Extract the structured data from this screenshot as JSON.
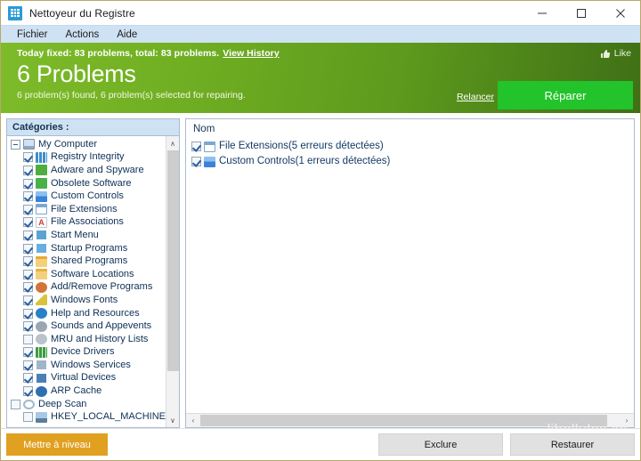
{
  "window": {
    "title": "Nettoyeur du Registre",
    "icon": "registry-app-icon",
    "minimize": "─",
    "maximize": "□",
    "close": "✕"
  },
  "menubar": {
    "items": [
      {
        "label": "Fichier"
      },
      {
        "label": "Actions"
      },
      {
        "label": "Aide"
      }
    ]
  },
  "hero": {
    "status_line": "Today fixed: 83 problems, total: 83 problems.",
    "view_history": "View History",
    "count_title": "6 Problems",
    "subtitle": "6 problem(s) found, 6 problem(s) selected for repairing.",
    "like_label": "Like",
    "rescan_label": "Relancer",
    "repair_label": "Réparer",
    "repair_color": "#23c32b",
    "gradient_from": "#7ebb2a",
    "gradient_to": "#3f7016"
  },
  "categories_panel": {
    "header": "Catégories :",
    "root": {
      "label": "My Computer",
      "icon": "computer-icon",
      "expanded": true
    },
    "items": [
      {
        "label": "Registry Integrity",
        "icon": "registry-integrity-icon",
        "checked": true,
        "color": "#3d8ec9"
      },
      {
        "label": "Adware and Spyware",
        "icon": "shield-icon",
        "checked": true,
        "color": "#4fae3f"
      },
      {
        "label": "Obsolete Software",
        "icon": "trash-icon",
        "checked": true,
        "color": "#49b04a"
      },
      {
        "label": "Custom Controls",
        "icon": "network-nodes-icon",
        "checked": true,
        "color": "#3b82d8"
      },
      {
        "label": "File Extensions",
        "icon": "file-lines-icon",
        "checked": true,
        "color": "#7aa8d0"
      },
      {
        "label": "File Associations",
        "icon": "letter-a-icon",
        "checked": true,
        "color": "#cf3b2e"
      },
      {
        "label": "Start Menu",
        "icon": "start-menu-icon",
        "checked": true,
        "color": "#5ba3d0"
      },
      {
        "label": "Startup Programs",
        "icon": "window-icon",
        "checked": true,
        "color": "#6aaede"
      },
      {
        "label": "Shared Programs",
        "icon": "folder-arrow-icon",
        "checked": true,
        "color": "#e7a93a"
      },
      {
        "label": "Software Locations",
        "icon": "folder-icon",
        "checked": true,
        "color": "#e9b03c"
      },
      {
        "label": "Add/Remove Programs",
        "icon": "cd-disc-icon",
        "checked": true,
        "color": "#d2743a"
      },
      {
        "label": "Windows Fonts",
        "icon": "font-icon",
        "checked": true,
        "color": "#d9c23c"
      },
      {
        "label": "Help and Resources",
        "icon": "help-question-icon",
        "checked": true,
        "color": "#2a7fc9"
      },
      {
        "label": "Sounds and Appevents",
        "icon": "speaker-icon",
        "checked": true,
        "color": "#9aa7b2"
      },
      {
        "label": "MRU and History Lists",
        "icon": "history-icon",
        "checked": false,
        "color": "#b9c3cc"
      },
      {
        "label": "Device Drivers",
        "icon": "device-chip-icon",
        "checked": true,
        "color": "#3f9a3f"
      },
      {
        "label": "Windows Services",
        "icon": "services-icon",
        "checked": true,
        "color": "#9fb6c8"
      },
      {
        "label": "Virtual Devices",
        "icon": "virtual-device-icon",
        "checked": true,
        "color": "#4b7fb5"
      },
      {
        "label": "ARP Cache",
        "icon": "arp-cache-icon",
        "checked": true,
        "color": "#2f6fb0"
      }
    ],
    "deep_scan": {
      "label": "Deep Scan",
      "icon": "magnifier-icon",
      "checked": false
    },
    "deep_scan_items": [
      {
        "label": "HKEY_LOCAL_MACHINE",
        "icon": "registry-key-icon",
        "checked": false
      }
    ]
  },
  "results_panel": {
    "header": "Nom",
    "rows": [
      {
        "label": "File Extensions(5 erreurs détectées)",
        "icon": "file-lines-icon",
        "checked": true,
        "color": "#7aa8d0"
      },
      {
        "label": "Custom Controls(1 erreurs détectées)",
        "icon": "network-nodes-icon",
        "checked": true,
        "color": "#3b82d8"
      }
    ]
  },
  "watermark": "libellules.ch",
  "footer": {
    "upgrade_label": "Mettre à niveau",
    "upgrade_color": "#e0a020",
    "exclude_label": "Exclure",
    "restore_label": "Restaurer"
  },
  "scrollbars": {
    "up_arrow": "∧",
    "down_arrow": "∨",
    "left_arrow": "‹",
    "right_arrow": "›"
  }
}
